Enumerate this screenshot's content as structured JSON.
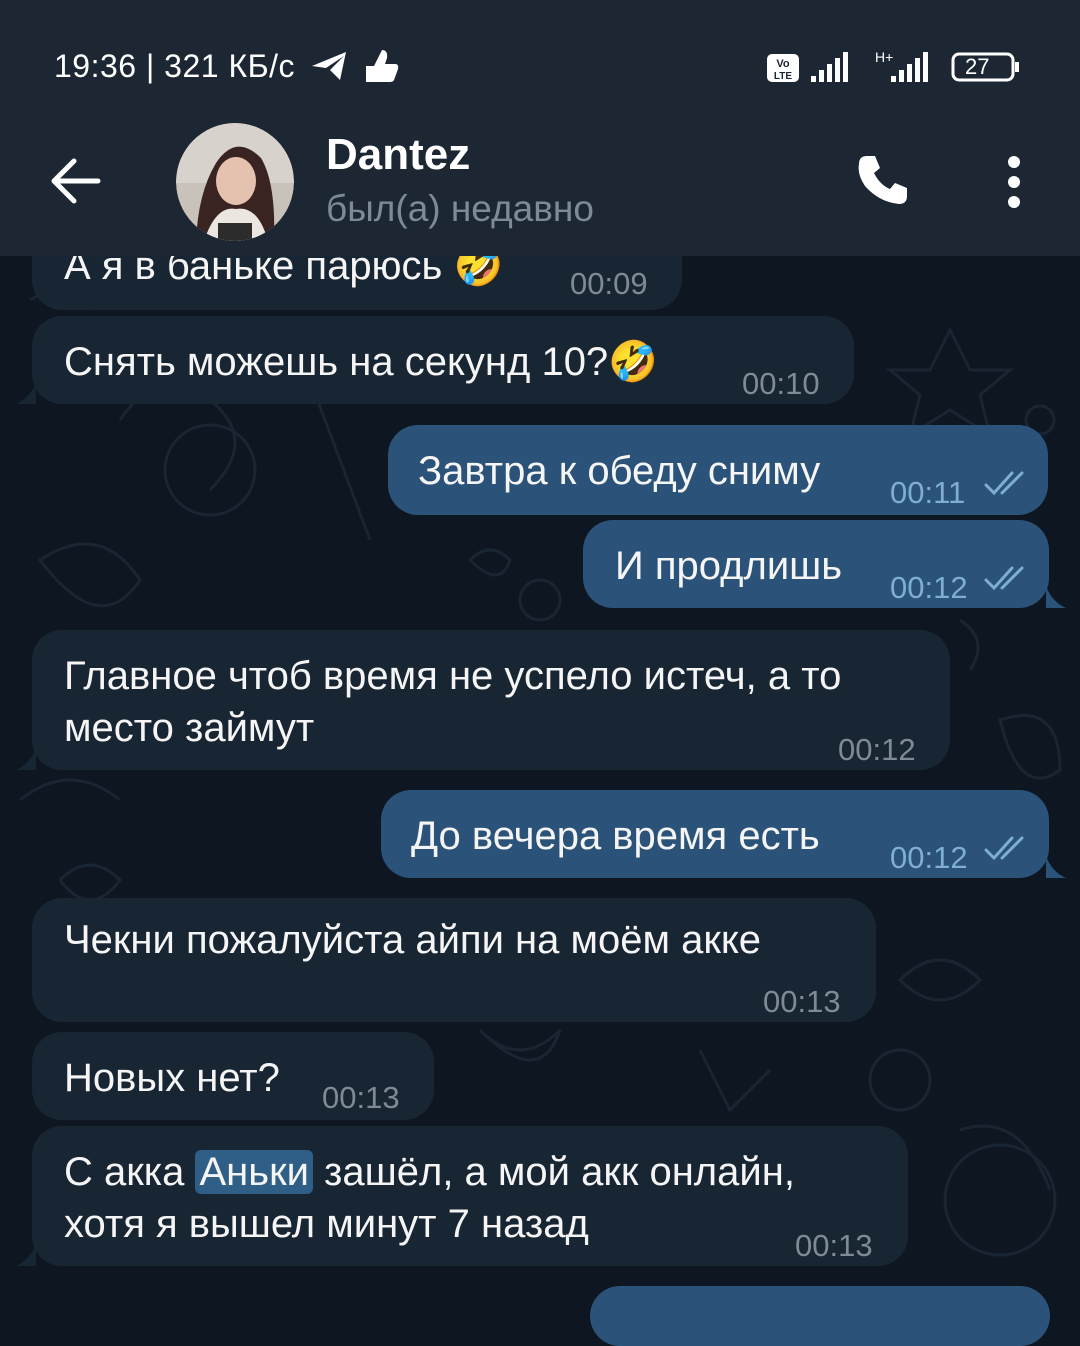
{
  "status_bar": {
    "time_speed": "19:36 | 321 КБ/с",
    "network1": "Vo LTE",
    "network2": "H+",
    "battery": "27"
  },
  "header": {
    "contact_name": "Dantez",
    "contact_status": "был(а) недавно"
  },
  "messages": [
    {
      "dir": "in",
      "text": "А я в баньке парюсь 🤣",
      "time": "00:09"
    },
    {
      "dir": "in",
      "text": "Снять можешь на секунд 10?🤣",
      "time": "00:10"
    },
    {
      "dir": "out",
      "text": "Завтра к обеду сниму",
      "time": "00:11"
    },
    {
      "dir": "out",
      "text": "И продлишь",
      "time": "00:12"
    },
    {
      "dir": "in",
      "line1": "Главное чтоб время не успело истеч, а то",
      "line2": "место займут",
      "time": "00:12"
    },
    {
      "dir": "out",
      "text": "До вечера время есть",
      "time": "00:12"
    },
    {
      "dir": "in",
      "text": "Чекни пожалуйста айпи на моём акке",
      "time": "00:13"
    },
    {
      "dir": "in",
      "text": "Новых нет?",
      "time": "00:13"
    },
    {
      "dir": "in",
      "pre": "С акка ",
      "highlight": "Аньки",
      "post": " зашёл, а мой акк онлайн,",
      "line2": "хотя я вышел минут 7 назад",
      "time": "00:13"
    }
  ],
  "colors": {
    "background": "#0e1621",
    "header": "#1d2733",
    "incoming_bubble": "#182533",
    "outgoing_bubble": "#2b5278",
    "highlight": "#2f5f86"
  }
}
